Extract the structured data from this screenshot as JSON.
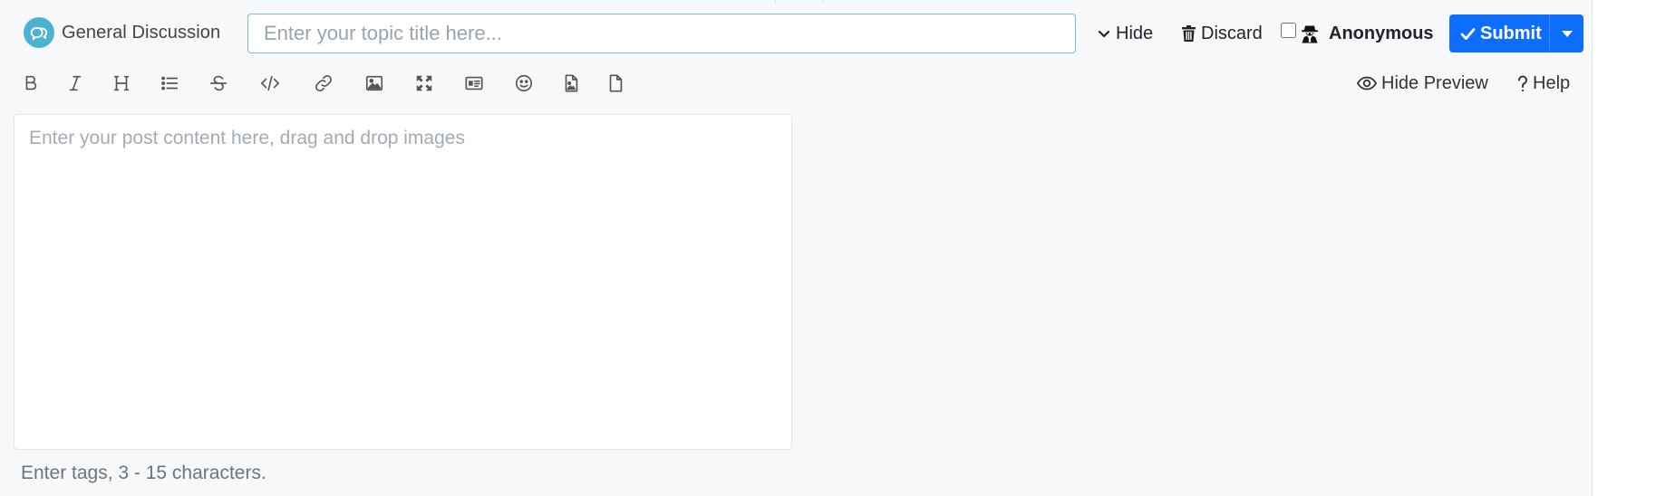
{
  "header": {
    "category": {
      "label": "General Discussion",
      "icon": "comments-icon",
      "color": "#4bb3d1"
    },
    "title_input": {
      "value": "",
      "placeholder": "Enter your topic title here..."
    },
    "hide_label": "Hide",
    "discard_label": "Discard",
    "anonymous": {
      "label": "Anonymous",
      "checked": false
    },
    "submit_label": "Submit",
    "submit_color": "#0d6efd"
  },
  "toolbar": {
    "buttons": [
      {
        "name": "bold",
        "icon": "bold-icon"
      },
      {
        "name": "italic",
        "icon": "italic-icon"
      },
      {
        "name": "heading",
        "icon": "heading-icon"
      },
      {
        "name": "list",
        "icon": "list-icon"
      },
      {
        "name": "strikethrough",
        "icon": "strikethrough-icon"
      },
      {
        "name": "code",
        "icon": "code-icon"
      },
      {
        "name": "link",
        "icon": "link-icon"
      },
      {
        "name": "image",
        "icon": "image-icon"
      },
      {
        "name": "zen",
        "icon": "expand-icon"
      },
      {
        "name": "thumbs",
        "icon": "id-card-icon"
      },
      {
        "name": "emoji",
        "icon": "smile-icon"
      },
      {
        "name": "upload-image",
        "icon": "file-image-icon"
      },
      {
        "name": "upload-file",
        "icon": "file-icon"
      }
    ],
    "hide_preview_label": "Hide Preview",
    "help_label": "Help"
  },
  "editor": {
    "value": "",
    "placeholder": "Enter your post content here, drag and drop images"
  },
  "tags": {
    "value": "",
    "placeholder": "Enter tags, 3 - 15 characters."
  }
}
